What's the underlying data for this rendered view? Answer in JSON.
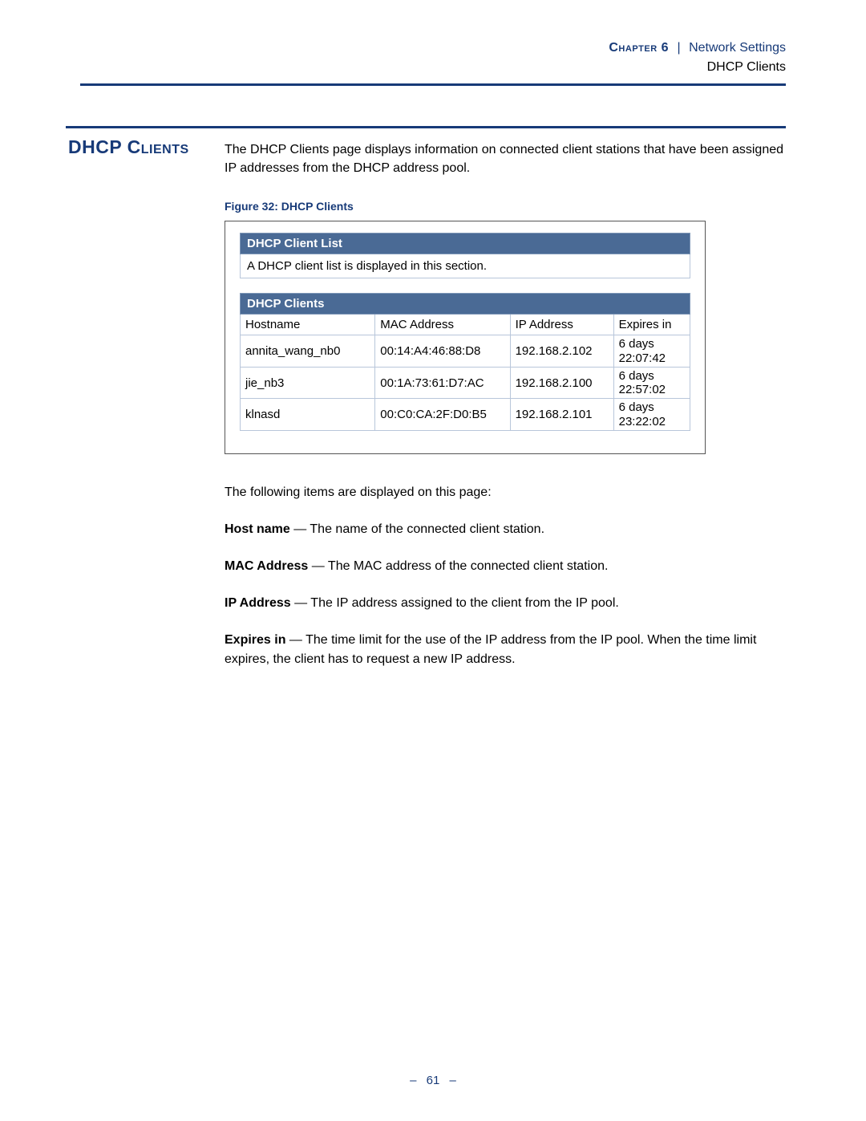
{
  "header": {
    "chapter_label": "Chapter 6",
    "divider": "|",
    "section": "Network Settings",
    "subsection": "DHCP Clients"
  },
  "section_title": "DHCP Clients",
  "intro": "The DHCP Clients page displays information on connected client stations that have been assigned IP addresses from the DHCP address pool.",
  "figure_caption": "Figure 32:  DHCP Clients",
  "screenshot": {
    "panel1_title": "DHCP Client List",
    "panel1_desc": "A DHCP client list is displayed in this section.",
    "table_title": "DHCP Clients",
    "columns": {
      "hostname": "Hostname",
      "mac": "MAC Address",
      "ip": "IP Address",
      "exp": "Expires in"
    },
    "rows": [
      {
        "hostname": "annita_wang_nb0",
        "mac": "00:14:A4:46:88:D8",
        "ip": "192.168.2.102",
        "exp_l1": "6 days",
        "exp_l2": "22:07:42"
      },
      {
        "hostname": "jie_nb3",
        "mac": "00:1A:73:61:D7:AC",
        "ip": "192.168.2.100",
        "exp_l1": "6 days",
        "exp_l2": "22:57:02"
      },
      {
        "hostname": "klnasd",
        "mac": "00:C0:CA:2F:D0:B5",
        "ip": "192.168.2.101",
        "exp_l1": "6 days",
        "exp_l2": "23:22:02"
      }
    ]
  },
  "post_intro": "The following items are displayed on this page:",
  "definitions": [
    {
      "term": "Host name",
      "desc": " — The name of the connected client station."
    },
    {
      "term": "MAC Address",
      "desc": " — The MAC address of the connected client station."
    },
    {
      "term": "IP Address",
      "desc": " — The IP address assigned to the client from the IP pool."
    },
    {
      "term": "Expires in",
      "desc": " — The time limit for the use of the IP address from the IP pool. When the time limit expires, the client has to request a new IP address."
    }
  ],
  "footer": {
    "dash": "–",
    "page": "61"
  }
}
